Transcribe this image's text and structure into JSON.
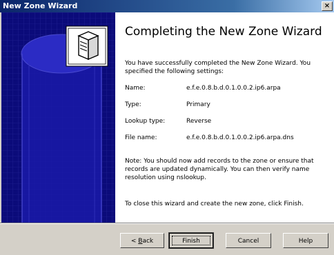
{
  "window": {
    "title": "New Zone Wizard",
    "close_glyph": "×"
  },
  "banner": {
    "icon": "server-icon",
    "colors": {
      "background": "#0b0b7a",
      "cylinder": "#1f1fb0",
      "grid": "#3a3ab8"
    }
  },
  "main": {
    "heading": "Completing the New Zone Wizard",
    "intro": "You have successfully completed the New Zone Wizard. You specified the following settings:",
    "settings": [
      {
        "label": "Name:",
        "value": "e.f.e.0.8.b.d.0.1.0.0.2.ip6.arpa"
      },
      {
        "label": "Type:",
        "value": "Primary"
      },
      {
        "label": "Lookup type:",
        "value": "Reverse"
      },
      {
        "label": "File name:",
        "value": "e.f.e.0.8.b.d.0.1.0.0.2.ip6.arpa.dns"
      }
    ],
    "note": "Note: You should now add records to the zone or ensure that records are updated dynamically. You can then verify name resolution using nslookup.",
    "closing": "To close this wizard and create the new zone, click Finish."
  },
  "buttons": {
    "back_prefix": "< ",
    "back_accel": "B",
    "back_rest": "ack",
    "finish": "Finish",
    "cancel": "Cancel",
    "help": "Help"
  }
}
